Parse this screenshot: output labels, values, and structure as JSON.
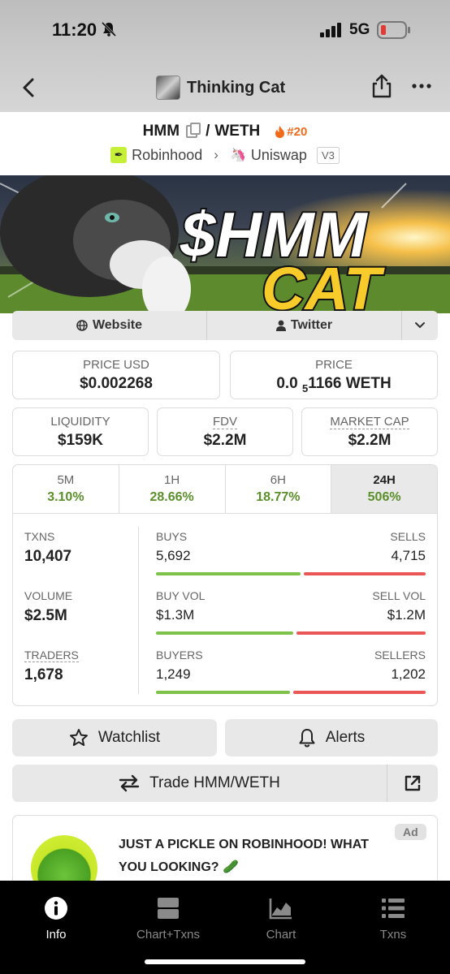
{
  "status": {
    "time": "11:20",
    "network": "5G"
  },
  "nav": {
    "title": "Thinking Cat"
  },
  "pair": {
    "base": "HMM",
    "separator": "/",
    "quote": "WETH",
    "rank": "#20"
  },
  "chain": {
    "name": "Robinhood",
    "dex": "Uniswap",
    "version": "V3"
  },
  "banner": {
    "line1": "$HMM",
    "line2": "CAT"
  },
  "links": {
    "website": "Website",
    "twitter": "Twitter"
  },
  "price": {
    "usd_label": "PRICE USD",
    "usd_value": "$0.002268",
    "native_label": "PRICE",
    "native_prefix": "0.0",
    "native_sub": "5",
    "native_rest": "1166 WETH"
  },
  "metrics": {
    "liquidity_label": "LIQUIDITY",
    "liquidity_value": "$159K",
    "fdv_label": "FDV",
    "fdv_value": "$2.2M",
    "mcap_label": "MARKET CAP",
    "mcap_value": "$2.2M"
  },
  "timeframes": [
    {
      "label": "5M",
      "value": "3.10%"
    },
    {
      "label": "1H",
      "value": "28.66%"
    },
    {
      "label": "6H",
      "value": "18.77%"
    },
    {
      "label": "24H",
      "value": "506%"
    }
  ],
  "stats": {
    "txns_label": "TXNS",
    "txns_value": "10,407",
    "buys_label": "BUYS",
    "buys_value": "5,692",
    "sells_label": "SELLS",
    "sells_value": "4,715",
    "volume_label": "VOLUME",
    "volume_value": "$2.5M",
    "buyvol_label": "BUY VOL",
    "buyvol_value": "$1.3M",
    "sellvol_label": "SELL VOL",
    "sellvol_value": "$1.2M",
    "traders_label": "TRADERS",
    "traders_value": "1,678",
    "buyers_label": "BUYERS",
    "buyers_value": "1,249",
    "sellers_label": "SELLERS",
    "sellers_value": "1,202"
  },
  "actions": {
    "watchlist": "Watchlist",
    "alerts": "Alerts",
    "trade": "Trade HMM/WETH"
  },
  "ad": {
    "text": "JUST A PICKLE ON ROBINHOOD! WHAT YOU LOOKING? 🥒",
    "tag": "Ad"
  },
  "tabbar": [
    {
      "label": "Info",
      "icon": "info-icon"
    },
    {
      "label": "Chart+Txns",
      "icon": "split-icon"
    },
    {
      "label": "Chart",
      "icon": "chart-icon"
    },
    {
      "label": "Txns",
      "icon": "list-icon"
    }
  ],
  "colors": {
    "positive": "#5a8f2a",
    "buy_bar": "#7ec24a",
    "sell_bar": "#eb5757",
    "rank": "#f06a1a"
  }
}
